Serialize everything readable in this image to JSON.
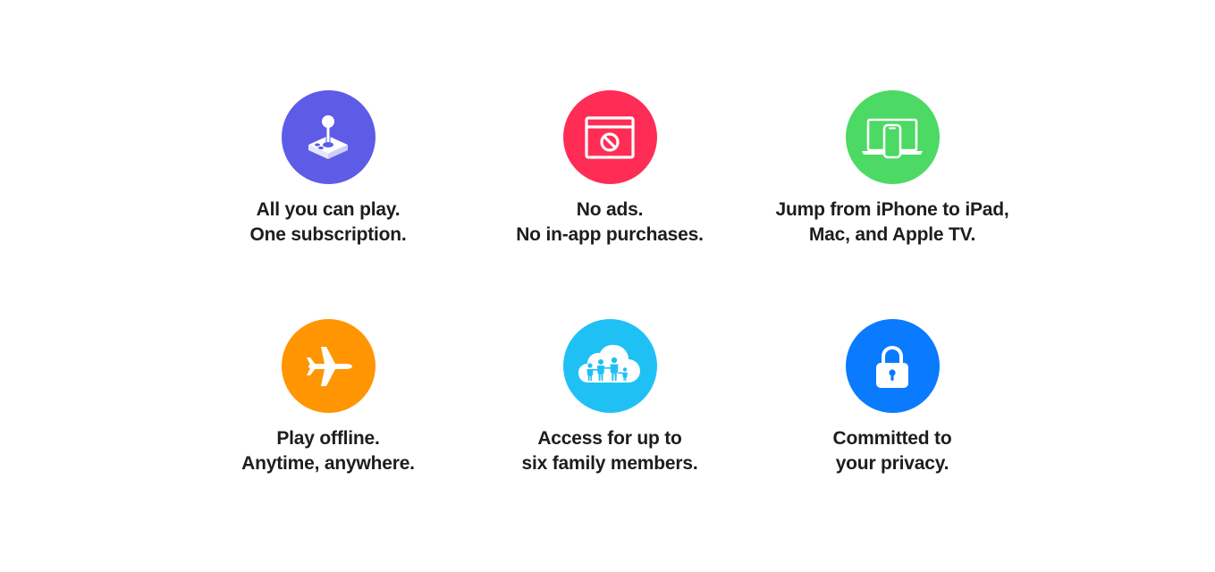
{
  "features": [
    {
      "id": "all-you-can-play",
      "icon": "arcade-joystick-icon",
      "color": "#5e5ce6",
      "line1": "All you can play.",
      "line2": "One subscription."
    },
    {
      "id": "no-ads",
      "icon": "no-ads-window-icon",
      "color": "#ff2d55",
      "line1": "No ads.",
      "line2": "No in-app purchases."
    },
    {
      "id": "cross-device",
      "icon": "laptop-phone-icon",
      "color": "#4cd964",
      "line1": "Jump from iPhone to iPad,",
      "line2": "Mac, and Apple TV."
    },
    {
      "id": "play-offline",
      "icon": "airplane-icon",
      "color": "#ff9500",
      "line1": "Play offline.",
      "line2": "Anytime, anywhere."
    },
    {
      "id": "family-sharing",
      "icon": "family-cloud-icon",
      "color": "#1fc1f5",
      "line1": "Access for up to",
      "line2": "six family members."
    },
    {
      "id": "privacy",
      "icon": "lock-icon",
      "color": "#0a7aff",
      "line1": "Committed to",
      "line2": "your privacy."
    }
  ]
}
